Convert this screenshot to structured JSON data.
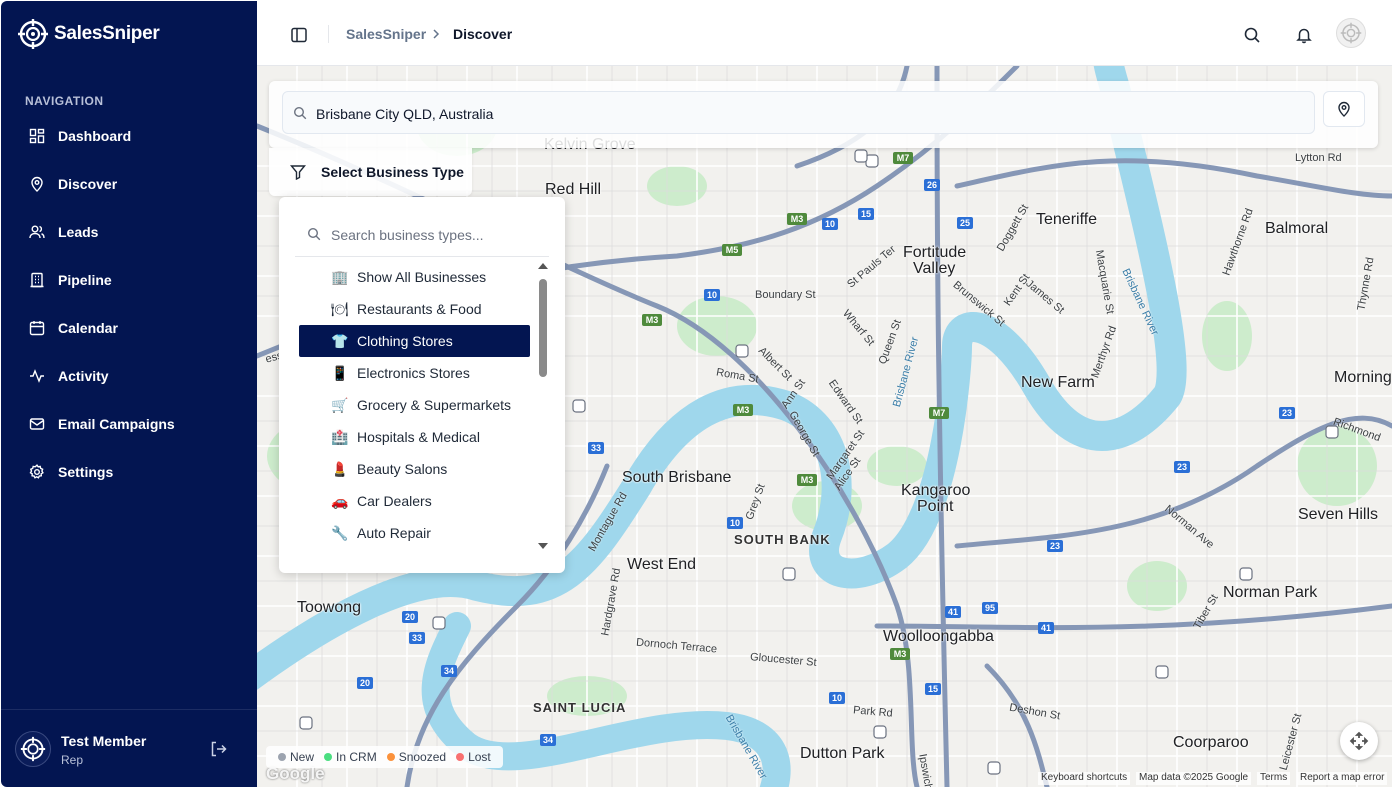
{
  "brand": {
    "name": "SalesSniper"
  },
  "nav": {
    "heading": "NAVIGATION",
    "items": [
      {
        "label": "Dashboard",
        "icon": "dashboard-icon"
      },
      {
        "label": "Discover",
        "icon": "map-pin-icon"
      },
      {
        "label": "Leads",
        "icon": "users-icon"
      },
      {
        "label": "Pipeline",
        "icon": "building-icon"
      },
      {
        "label": "Calendar",
        "icon": "calendar-icon"
      },
      {
        "label": "Activity",
        "icon": "activity-icon"
      },
      {
        "label": "Email Campaigns",
        "icon": "mail-icon"
      },
      {
        "label": "Settings",
        "icon": "gear-icon"
      }
    ]
  },
  "user": {
    "name": "Test Member",
    "role": "Rep"
  },
  "header": {
    "breadcrumb_root": "SalesSniper",
    "breadcrumb_current": "Discover"
  },
  "search": {
    "value": "Brisbane City QLD, Australia"
  },
  "filter": {
    "button_label": "Select Business Type",
    "search_placeholder": "Search business types...",
    "options": [
      {
        "label": "Show All Businesses",
        "icon": "🏢"
      },
      {
        "label": "Restaurants & Food",
        "icon": "🍽"
      },
      {
        "label": "Clothing Stores",
        "icon": "👕"
      },
      {
        "label": "Electronics Stores",
        "icon": "📱"
      },
      {
        "label": "Grocery & Supermarkets",
        "icon": "🛒"
      },
      {
        "label": "Hospitals & Medical",
        "icon": "🏥"
      },
      {
        "label": "Beauty Salons",
        "icon": "💄"
      },
      {
        "label": "Car Dealers",
        "icon": "🚗"
      },
      {
        "label": "Auto Repair",
        "icon": "🔧"
      }
    ],
    "selected": "Clothing Stores"
  },
  "legend": [
    {
      "label": "New",
      "color": "#9ca3af"
    },
    {
      "label": "In CRM",
      "color": "#4ade80"
    },
    {
      "label": "Snoozed",
      "color": "#fb923c"
    },
    {
      "label": "Lost",
      "color": "#f87171"
    }
  ],
  "map": {
    "places": {
      "kelvin_grove": "Kelvin Grove",
      "red_hill": "Red Hill",
      "teneriffe": "Teneriffe",
      "balmoral": "Balmoral",
      "fortitude": "Fortitude",
      "valley": "Valley",
      "new_farm": "New Farm",
      "morningside": "Morning",
      "south_brisbane": "South Brisbane",
      "kangaroo": "Kangaroo",
      "point": "Point",
      "seven_hills": "Seven Hills",
      "west_end": "West End",
      "south_bank": "SOUTH BANK",
      "toowong": "Toowong",
      "norman_park": "Norman Park",
      "woolloongabba": "Woolloongabba",
      "saint_lucia": "SAINT LUCIA",
      "dutton_park": "Dutton Park",
      "coorparoo": "Coorparoo"
    },
    "streets": {
      "lytton": "Lytton Rd",
      "boundary": "Boundary St",
      "st_pauls": "St Pauls Ter",
      "brunswick": "Brunswick St",
      "kent": "Kent St",
      "james": "James St",
      "doggett": "Doggett St",
      "macquarie": "Macquarie St",
      "merthyr": "Merthyr Rd",
      "hawthorne": "Hawthorne Rd",
      "thynne": "Thynne Rd",
      "wharf": "Wharf St",
      "queen": "Queen St",
      "albert": "Albert St",
      "roma": "Roma St",
      "ann": "Ann St",
      "edward": "Edward St",
      "george": "George St",
      "margaret": "Margaret St",
      "alice": "Alice St",
      "grey": "Grey St",
      "montague": "Montague Rd",
      "hardgrave": "Hardgrave Rd",
      "dornoch": "Dornoch Terrace",
      "gloucester": "Gloucester St",
      "park": "Park Rd",
      "ipswich": "Ipswich",
      "deshon": "Deshon St",
      "norman_ave": "Norman Ave",
      "tiber": "Tiber St",
      "leicester": "Leicester St",
      "richmond": "Richmond",
      "brisbane_river": "Brisbane River",
      "esser": "esser Ter"
    },
    "highways": {
      "m7": "M7",
      "m5": "M5",
      "m3": "M3",
      "r26": "26",
      "r25": "25",
      "r15": "15",
      "r10": "10",
      "r23": "23",
      "r33": "33",
      "r34": "34",
      "r20": "20",
      "r41": "41",
      "r95": "95"
    }
  },
  "attribution": {
    "google": "Google",
    "shortcuts": "Keyboard shortcuts",
    "mapdata": "Map data ©2025 Google",
    "terms": "Terms",
    "report": "Report a map error"
  }
}
